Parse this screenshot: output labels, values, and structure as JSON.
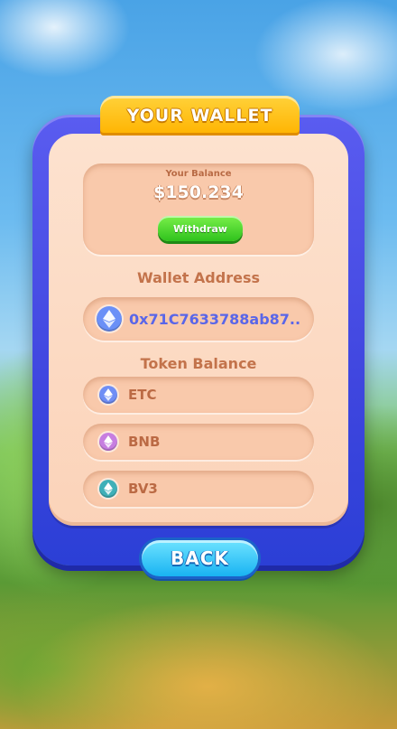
{
  "title": "YOUR WALLET",
  "balance": {
    "label": "Your Balance",
    "value": "$150.234",
    "withdraw_label": "Withdraw"
  },
  "wallet": {
    "label": "Wallet Address",
    "address": "0x71C7633788ab87..",
    "icon": "ethereum-icon"
  },
  "tokens": {
    "label": "Token Balance",
    "items": [
      {
        "symbol": "ETC",
        "icon": "ethereum-classic-icon",
        "color": "#6f8ef5"
      },
      {
        "symbol": "BNB",
        "icon": "bnb-icon",
        "color": "#c77ee0"
      },
      {
        "symbol": "BV3",
        "icon": "bv3-icon",
        "color": "#3fb0b8"
      }
    ]
  },
  "back_label": "BACK"
}
